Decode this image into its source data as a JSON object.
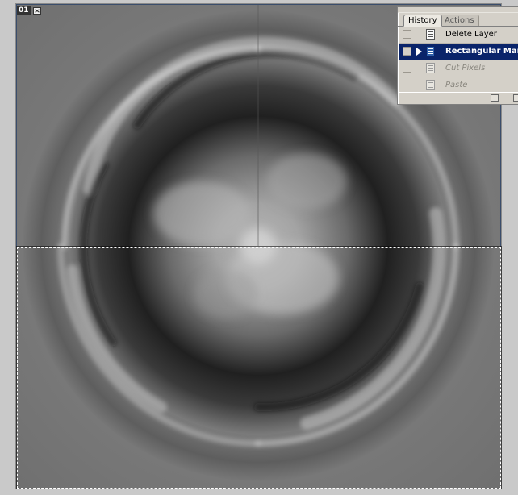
{
  "document": {
    "indicator_label": "01",
    "indicator_icon": "document-window-icon"
  },
  "history_panel": {
    "tabs": [
      {
        "label": "History",
        "active": true
      },
      {
        "label": "Actions",
        "active": false
      }
    ],
    "states": [
      {
        "label": "Delete Layer",
        "state": "past",
        "icon": "history-state-icon"
      },
      {
        "label": "Rectangular Marque",
        "state": "current",
        "icon": "history-state-icon"
      },
      {
        "label": "Cut Pixels",
        "state": "future",
        "icon": "history-state-icon"
      },
      {
        "label": "Paste",
        "state": "future",
        "icon": "history-state-icon"
      }
    ],
    "footer_icons": [
      "create-new-document-icon",
      "new-snapshot-icon"
    ]
  },
  "colors": {
    "selection_highlight": "#0a246a",
    "panel_bg": "#d4d0c8",
    "workspace_bg": "#c9c9c9"
  }
}
